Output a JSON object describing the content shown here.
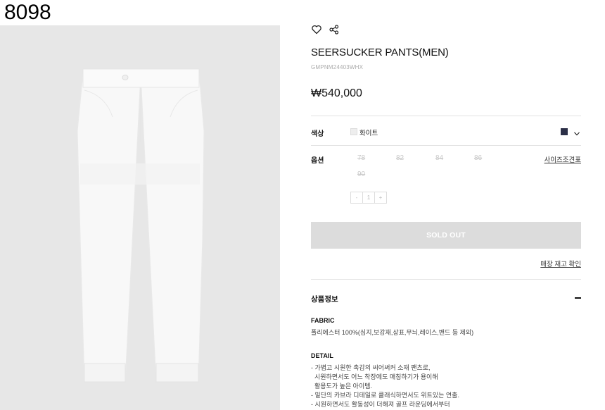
{
  "page_code": "8098",
  "product": {
    "title": "SEERSUCKER PANTS(MEN)",
    "sku": "GMPNM24403WHX",
    "price": "₩540,000"
  },
  "color": {
    "label": "색상",
    "selected": "화이트",
    "accent_navy": "#2b2f47"
  },
  "option": {
    "label": "옵션",
    "sizes": [
      "78",
      "82",
      "84",
      "86",
      "90"
    ],
    "size_guide": "사이즈조견표",
    "stepper": {
      "minus": "-",
      "qty": "1",
      "plus": "+"
    }
  },
  "soldout_label": "SOLD OUT",
  "stock_check": "매장 재고 확인",
  "info_section": {
    "title": "상품정보",
    "fabric_heading": "FABRIC",
    "fabric_text": "폴리에스터 100%(심지,보강재,상표,무늬,레이스,밴드 등 제외)",
    "detail_heading": "DETAIL",
    "detail_lines": [
      "- 가볍고 시원한 촉감의 씨어써커 소재 팬츠로,",
      "  시원하면서도 어느 착장에도 매칭하기가 용이해",
      "  활용도가 높은 아이템.",
      "- 밑단의 카브라 디테일로 클래식하면서도 위트있는 연출.",
      "- 시원하면서도 활동성이 더해져 골프 라운딩에서부터"
    ]
  },
  "icons": {
    "wishlist": "heart-icon",
    "share": "share-icon",
    "expand": "chevron-down-icon",
    "collapse": "minus-icon"
  }
}
